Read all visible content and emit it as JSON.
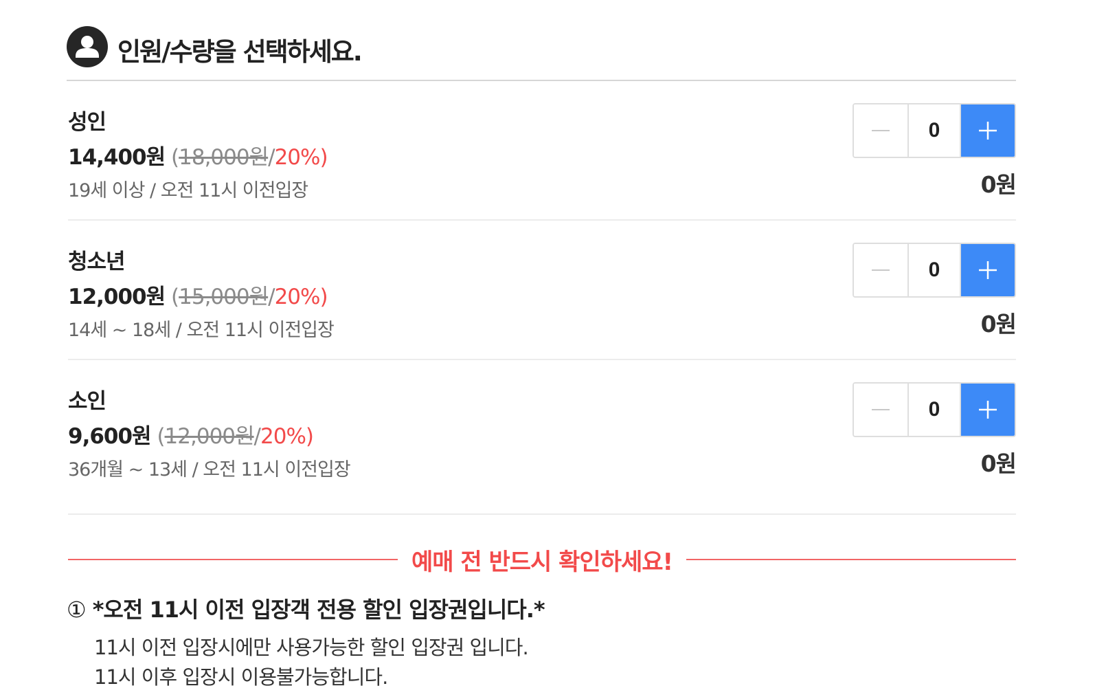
{
  "header": {
    "title": "인원/수량을 선택하세요.",
    "icon": "user-icon"
  },
  "tickets": [
    {
      "name": "성인",
      "sale_price": "14,400원",
      "original_price": "18,000원",
      "discount": "20%",
      "description": "19세 이상 / 오전 11시 이전입장",
      "quantity": "0",
      "subtotal": "0원"
    },
    {
      "name": "청소년",
      "sale_price": "12,000원",
      "original_price": "15,000원",
      "discount": "20%",
      "description": "14세 ~ 18세 / 오전 11시 이전입장",
      "quantity": "0",
      "subtotal": "0원"
    },
    {
      "name": "소인",
      "sale_price": "9,600원",
      "original_price": "12,000원",
      "discount": "20%",
      "description": "36개월 ~ 13세 / 오전 11시 이전입장",
      "quantity": "0",
      "subtotal": "0원"
    }
  ],
  "notice": {
    "title": "예매 전 반드시 확인하세요!",
    "item_number": "①",
    "item_title": "*오전 11시 이전 입장객 전용 할인 입장권입니다.*",
    "lines": [
      "11시 이전 입장시에만 사용가능한 할인 입장권 입니다.",
      "11시 이후 입장시 이용불가능합니다."
    ]
  },
  "colors": {
    "accent_blue": "#3d8af7",
    "discount_red": "#f24a4a",
    "icon_dark": "#262626"
  }
}
